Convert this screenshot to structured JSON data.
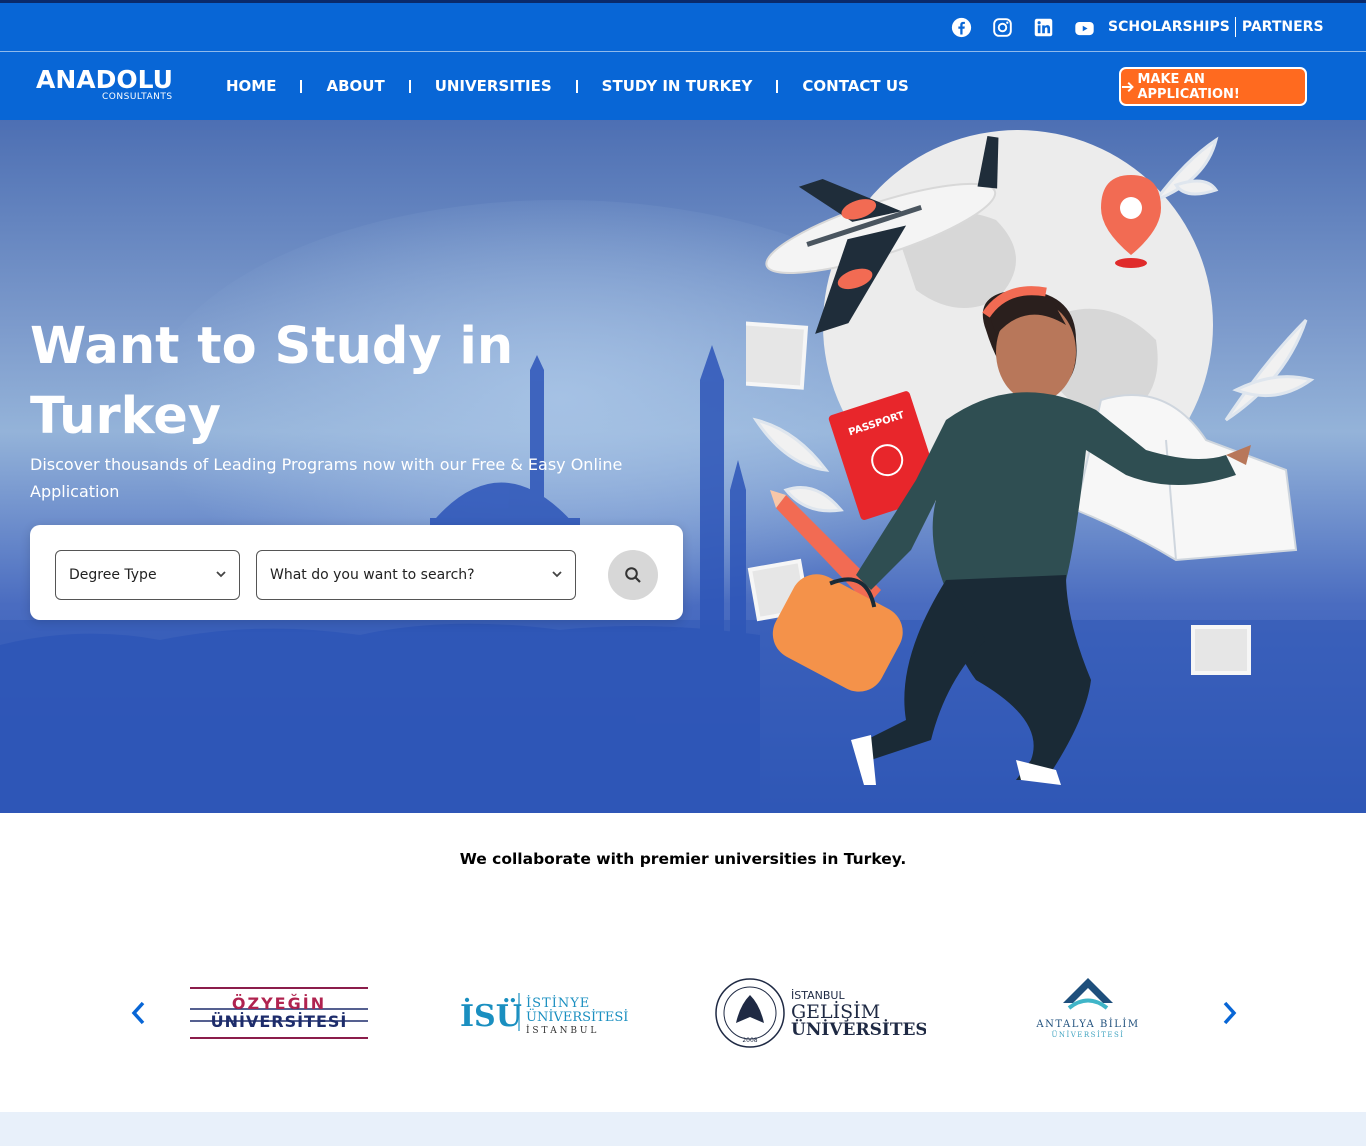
{
  "topbar": {
    "social_icons": [
      "facebook-icon",
      "instagram-icon",
      "linkedin-icon",
      "youtube-icon"
    ],
    "links": [
      "SCHOLARSHIPS",
      "PARTNERS"
    ]
  },
  "brand": {
    "name": "ANADOLU",
    "tagline": "CONSULTANTS"
  },
  "nav": {
    "items": [
      "HOME",
      "ABOUT",
      "UNIVERSITIES",
      "STUDY IN TURKEY",
      "CONTACT US"
    ],
    "cta": "MAKE AN APPLICATION!"
  },
  "hero": {
    "title": "Want to Study in Turkey",
    "subtitle": "Discover thousands of Leading Programs now with our Free & Easy Online Application",
    "search": {
      "degree_select": "Degree Type",
      "query_select": "What do you want to search?"
    },
    "illustration_labels": {
      "passport": "PASSPORT"
    }
  },
  "partners": {
    "heading": "We collaborate with premier universities in Turkey.",
    "logos": [
      {
        "line1": "ÖZYEĞİN",
        "line2": "ÜNİVERSİTESİ"
      },
      {
        "mark": "İSÜ",
        "line1": "İSTİNYE",
        "line2": "ÜNİVERSİTESİ",
        "line3": "İ S T A N B U L"
      },
      {
        "line0": "İSTANBUL",
        "line1": "GELİŞİM",
        "line2": "ÜNİVERSİTESİ",
        "seal_year": "2008"
      },
      {
        "line1": "ANTALYA BİLİM",
        "line2": "ÜNİVERSİTESİ"
      }
    ]
  },
  "colors": {
    "primary": "#0866d6",
    "accent": "#ff6a1f",
    "hero_dark": "#2f57b6"
  }
}
